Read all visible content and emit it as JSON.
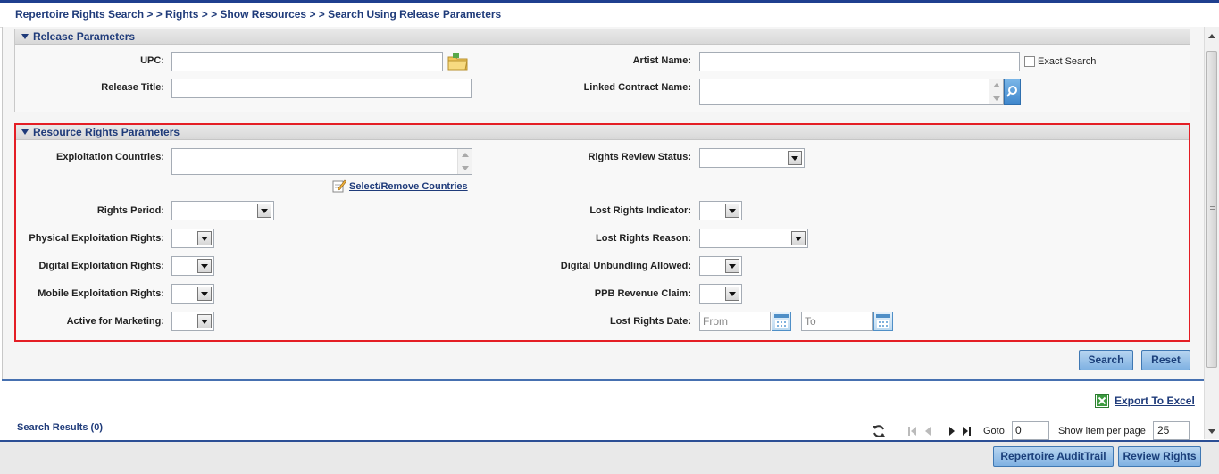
{
  "breadcrumb": "Repertoire Rights Search > > Rights > > Show Resources > > Search Using Release Parameters",
  "release_panel": {
    "title": "Release Parameters",
    "upc_label": "UPC:",
    "upc_value": "",
    "artist_label": "Artist Name:",
    "artist_value": "",
    "exact_search_label": "Exact Search",
    "release_title_label": "Release Title:",
    "release_title_value": "",
    "linked_contract_label": "Linked Contract Name:"
  },
  "resource_panel": {
    "title": "Resource Rights Parameters",
    "exploitation_countries_label": "Exploitation Countries:",
    "select_remove_countries": "Select/Remove Countries",
    "rights_review_status_label": "Rights Review Status:",
    "rights_period_label": "Rights Period:",
    "lost_rights_indicator_label": "Lost Rights Indicator:",
    "physical_label": "Physical Exploitation Rights:",
    "lost_rights_reason_label": "Lost Rights Reason:",
    "digital_label": "Digital Exploitation Rights:",
    "digital_unbundling_label": "Digital Unbundling Allowed:",
    "mobile_label": "Mobile Exploitation Rights:",
    "ppb_label": "PPB Revenue Claim:",
    "active_marketing_label": "Active for Marketing:",
    "lost_rights_date_label": "Lost Rights Date:",
    "from_placeholder": "From",
    "to_placeholder": "To"
  },
  "actions": {
    "search": "Search",
    "reset": "Reset"
  },
  "results": {
    "export_label": "Export To Excel",
    "title": "Search Results (0)",
    "goto_label": "Goto",
    "goto_value": "0",
    "per_page_label": "Show item per page",
    "per_page_value": "25"
  },
  "footer": {
    "audit_trail": "Repertoire AuditTrail",
    "review_rights": "Review Rights"
  },
  "colors": {
    "accent": "#1f3b7a",
    "highlight_border": "#e41e25",
    "button": "#7fb1e2"
  },
  "icons": [
    "folder-icon",
    "search-icon",
    "edit-icon",
    "calendar-icon",
    "refresh-icon",
    "excel-icon",
    "dropdown-arrow-icon"
  ]
}
